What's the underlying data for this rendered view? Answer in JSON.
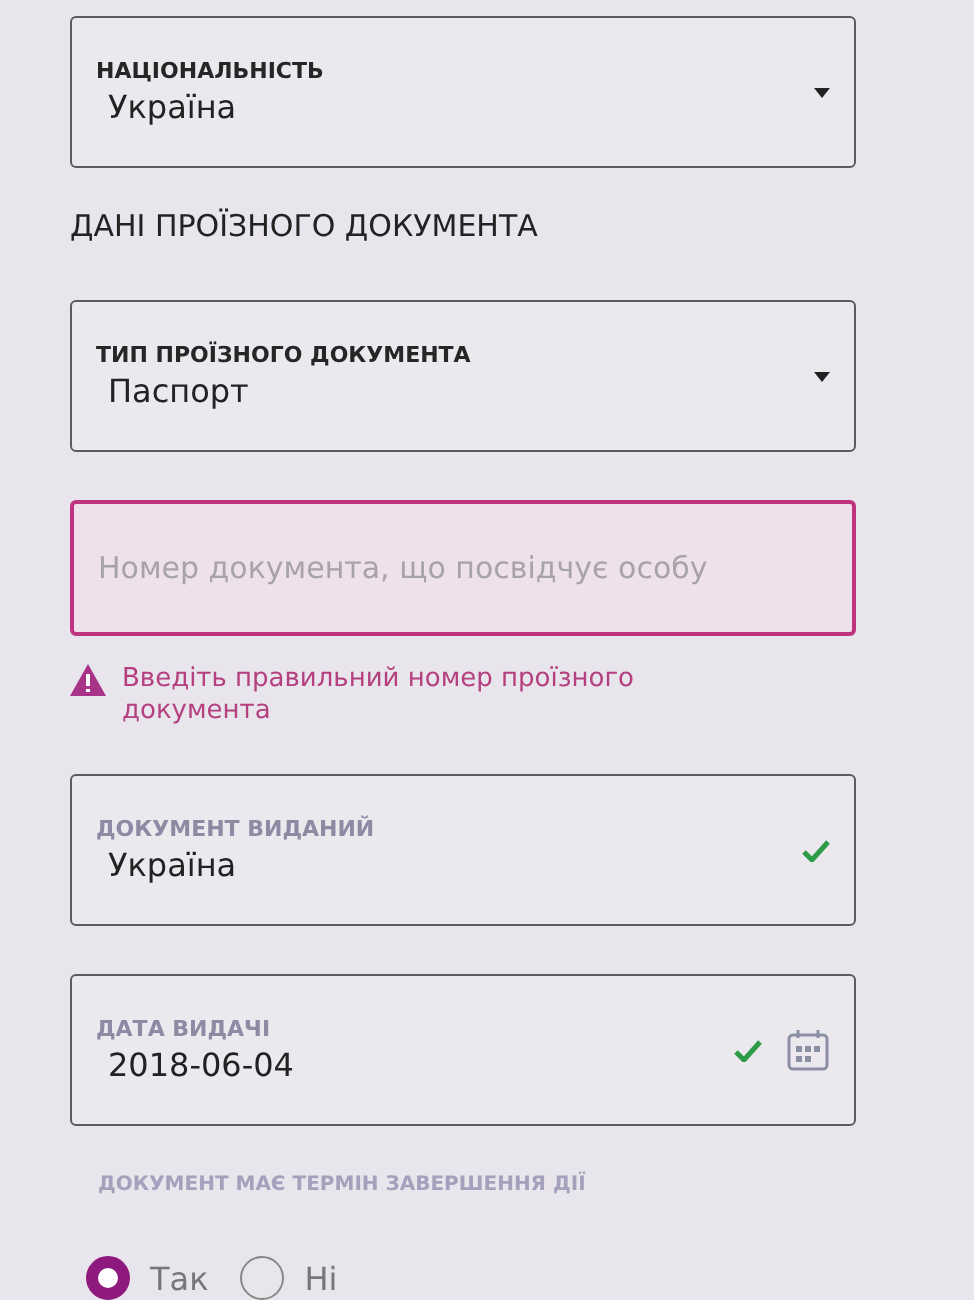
{
  "nationality": {
    "kind": "select",
    "label": "НАЦІОНАЛЬНІСТЬ",
    "value": "Україна"
  },
  "section_title": "ДАНІ ПРОЇЗНОГО ДОКУМЕНТА",
  "fields": [
    {
      "kind": "select",
      "label": "ТИП ПРОЇЗНОГО ДОКУМЕНТА",
      "value": "Паспорт",
      "valid": false,
      "error": false
    },
    {
      "kind": "text",
      "placeholder": "Номер документа, що посвідчує особу",
      "error": true,
      "error_message": "Введіть правильний номер проїзного документа"
    },
    {
      "kind": "text",
      "label": "ДОКУМЕНТ ВИДАНИЙ",
      "value": "Україна",
      "valid": true,
      "error": false
    },
    {
      "kind": "date",
      "label": "ДАТА ВИДАЧІ",
      "value": "2018-06-04",
      "valid": true,
      "error": false
    }
  ],
  "expiry_question": {
    "label": "ДОКУМЕНТ МАЄ ТЕРМІН ЗАВЕРШЕННЯ ДІЇ",
    "options": [
      {
        "label": "Так",
        "selected": true
      },
      {
        "label": "Ні",
        "selected": false
      }
    ]
  }
}
